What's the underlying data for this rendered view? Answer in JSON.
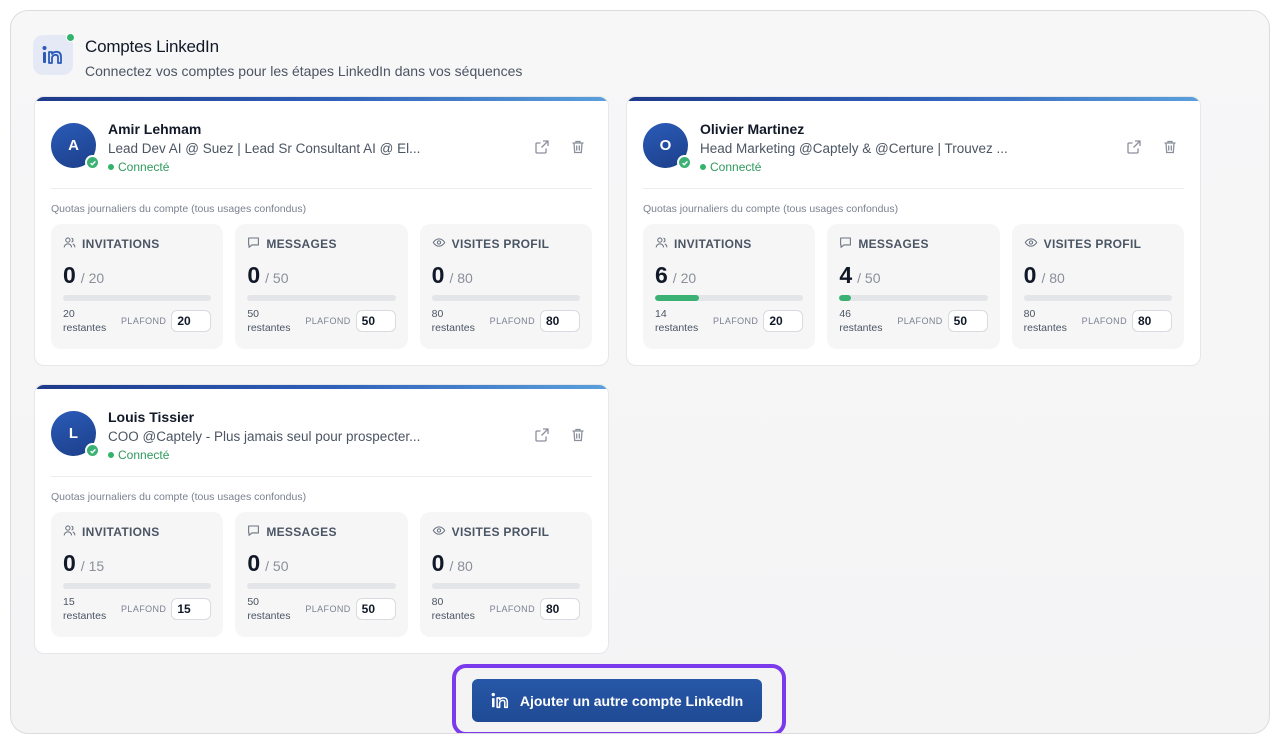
{
  "header": {
    "title": "Comptes LinkedIn",
    "subtitle": "Connectez vos comptes pour les étapes LinkedIn dans vos séquences",
    "icon": "linkedin-icon"
  },
  "colors": {
    "accent": "#1f4a94",
    "connected": "#34b36b",
    "highlight": "#7c3aed"
  },
  "accounts": [
    {
      "initial": "A",
      "name": "Amir Lehmam",
      "headline": "Lead Dev AI @ Suez | Lead Sr Consultant AI @ El...",
      "status": "Connecté",
      "quota_label": "Quotas journaliers du compte (tous usages confondus)",
      "quotas": [
        {
          "label": "INVITATIONS",
          "icon": "users-icon",
          "used": "0",
          "max": "/ 20",
          "progress": 0,
          "remaining_count": "20",
          "remaining_text": "restantes",
          "cap_label": "PLAFOND",
          "cap": "20"
        },
        {
          "label": "MESSAGES",
          "icon": "message-icon",
          "used": "0",
          "max": "/ 50",
          "progress": 0,
          "remaining_count": "50",
          "remaining_text": "restantes",
          "cap_label": "PLAFOND",
          "cap": "50"
        },
        {
          "label": "VISITES PROFIL",
          "icon": "eye-icon",
          "used": "0",
          "max": "/ 80",
          "progress": 0,
          "remaining_count": "80",
          "remaining_text": "restantes",
          "cap_label": "PLAFOND",
          "cap": "80"
        }
      ]
    },
    {
      "initial": "O",
      "name": "Olivier Martinez",
      "headline": "Head Marketing @Captely & @Certure | Trouvez ...",
      "status": "Connecté",
      "quota_label": "Quotas journaliers du compte (tous usages confondus)",
      "quotas": [
        {
          "label": "INVITATIONS",
          "icon": "users-icon",
          "used": "6",
          "max": "/ 20",
          "progress": 0.3,
          "remaining_count": "14",
          "remaining_text": "restantes",
          "cap_label": "PLAFOND",
          "cap": "20"
        },
        {
          "label": "MESSAGES",
          "icon": "message-icon",
          "used": "4",
          "max": "/ 50",
          "progress": 0.08,
          "remaining_count": "46",
          "remaining_text": "restantes",
          "cap_label": "PLAFOND",
          "cap": "50"
        },
        {
          "label": "VISITES PROFIL",
          "icon": "eye-icon",
          "used": "0",
          "max": "/ 80",
          "progress": 0,
          "remaining_count": "80",
          "remaining_text": "restantes",
          "cap_label": "PLAFOND",
          "cap": "80"
        }
      ]
    },
    {
      "initial": "L",
      "name": "Louis Tissier",
      "headline": "COO @Captely - Plus jamais seul pour prospecter...",
      "status": "Connecté",
      "quota_label": "Quotas journaliers du compte (tous usages confondus)",
      "quotas": [
        {
          "label": "INVITATIONS",
          "icon": "users-icon",
          "used": "0",
          "max": "/ 15",
          "progress": 0,
          "remaining_count": "15",
          "remaining_text": "restantes",
          "cap_label": "PLAFOND",
          "cap": "15"
        },
        {
          "label": "MESSAGES",
          "icon": "message-icon",
          "used": "0",
          "max": "/ 50",
          "progress": 0,
          "remaining_count": "50",
          "remaining_text": "restantes",
          "cap_label": "PLAFOND",
          "cap": "50"
        },
        {
          "label": "VISITES PROFIL",
          "icon": "eye-icon",
          "used": "0",
          "max": "/ 80",
          "progress": 0,
          "remaining_count": "80",
          "remaining_text": "restantes",
          "cap_label": "PLAFOND",
          "cap": "80"
        }
      ]
    }
  ],
  "add_button": {
    "label": "Ajouter un autre compte LinkedIn",
    "icon": "linkedin-icon"
  }
}
